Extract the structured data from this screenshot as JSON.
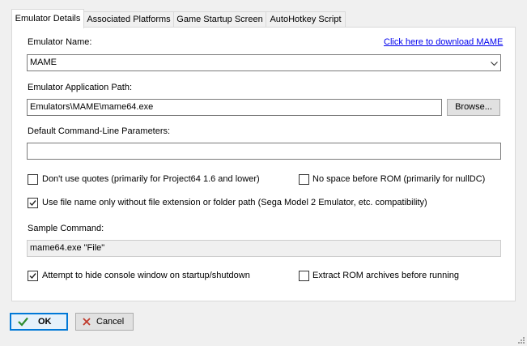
{
  "tabs": [
    {
      "label": "Emulator Details",
      "active": true
    },
    {
      "label": "Associated Platforms",
      "active": false
    },
    {
      "label": "Game Startup Screen",
      "active": false
    },
    {
      "label": "AutoHotkey Script",
      "active": false
    }
  ],
  "details": {
    "emulator_name_label": "Emulator Name:",
    "download_link": "Click here to download MAME",
    "emulator_name_value": "MAME",
    "app_path_label": "Emulator Application Path:",
    "app_path_value": "Emulators\\MAME\\mame64.exe",
    "browse_label": "Browse...",
    "cmd_params_label": "Default Command-Line Parameters:",
    "cmd_params_value": "",
    "options": {
      "no_quotes": {
        "label": "Don't use quotes (primarily for Project64 1.6 and lower)",
        "checked": false
      },
      "no_space": {
        "label": "No space before ROM (primarily for nullDC)",
        "checked": false
      },
      "file_name_only": {
        "label": "Use file name only without file extension or folder path (Sega Model 2 Emulator, etc. compatibility)",
        "checked": true
      }
    },
    "sample_command_label": "Sample Command:",
    "sample_command_value": "mame64.exe \"File\"",
    "hide_console": {
      "label": "Attempt to hide console window on startup/shutdown",
      "checked": true
    },
    "extract_rom": {
      "label": "Extract ROM archives before running",
      "checked": false
    }
  },
  "footer": {
    "ok_label": "OK",
    "cancel_label": "Cancel"
  },
  "colors": {
    "link": "#0000ee",
    "ok_check": "#2e8b2e",
    "cancel_x": "#c0392b",
    "focus_border": "#0078d7"
  }
}
